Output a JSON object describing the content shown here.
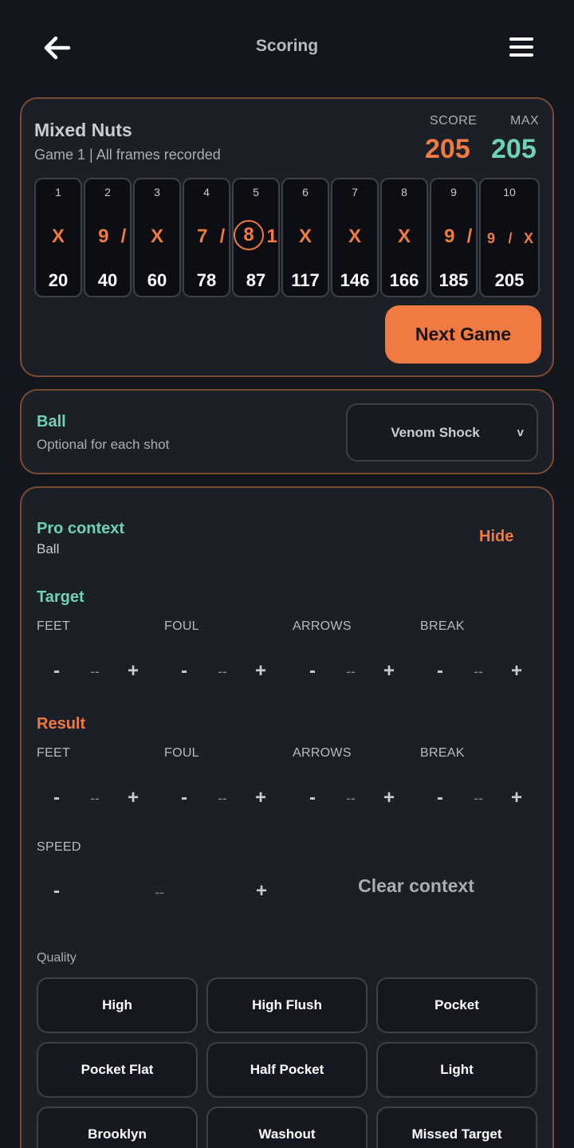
{
  "header": {
    "title": "Scoring",
    "back_icon": "arrow-left-icon",
    "menu_icon": "hamburger-menu-icon"
  },
  "game": {
    "team": "Mixed Nuts",
    "status": "Game 1 | All frames recorded",
    "score_label": "SCORE",
    "score": "205",
    "max_label": "MAX",
    "max": "205"
  },
  "frames": [
    {
      "num": "1",
      "shots": [
        "X"
      ],
      "total": "20"
    },
    {
      "num": "2",
      "shots": [
        "9",
        "/"
      ],
      "total": "40"
    },
    {
      "num": "3",
      "shots": [
        "X"
      ],
      "total": "60"
    },
    {
      "num": "4",
      "shots": [
        "7",
        "/"
      ],
      "total": "78"
    },
    {
      "num": "5",
      "shots": [
        "8",
        "1"
      ],
      "total": "87",
      "split_first": true
    },
    {
      "num": "6",
      "shots": [
        "X"
      ],
      "total": "117"
    },
    {
      "num": "7",
      "shots": [
        "X"
      ],
      "total": "146"
    },
    {
      "num": "8",
      "shots": [
        "X"
      ],
      "total": "166"
    },
    {
      "num": "9",
      "shots": [
        "9",
        "/"
      ],
      "total": "185"
    },
    {
      "num": "10",
      "shots": [
        "9",
        "/",
        "X"
      ],
      "total": "205"
    }
  ],
  "next_game_label": "Next Game",
  "ball": {
    "label": "Ball",
    "sub": "Optional for each shot",
    "selected": "Venom Shock",
    "chevron": "v"
  },
  "pro": {
    "title": "Pro context",
    "sub": "Ball",
    "hide_label": "Hide",
    "target_title": "Target",
    "result_title": "Result",
    "fields": [
      "FEET",
      "FOUL",
      "ARROWS",
      "BREAK"
    ],
    "speed_label": "SPEED",
    "minus": "-",
    "plus": "+",
    "empty_value": "--",
    "clear_label": "Clear context",
    "quality_label": "Quality",
    "quality_options": [
      "High",
      "High Flush",
      "Pocket",
      "Pocket Flat",
      "Half Pocket",
      "Light",
      "Brooklyn",
      "Washout",
      "Missed Target"
    ]
  },
  "colors": {
    "accent": "#ef7a42",
    "teal": "#6fd1b9",
    "background": "#13161c",
    "card": "#1b1f28"
  }
}
